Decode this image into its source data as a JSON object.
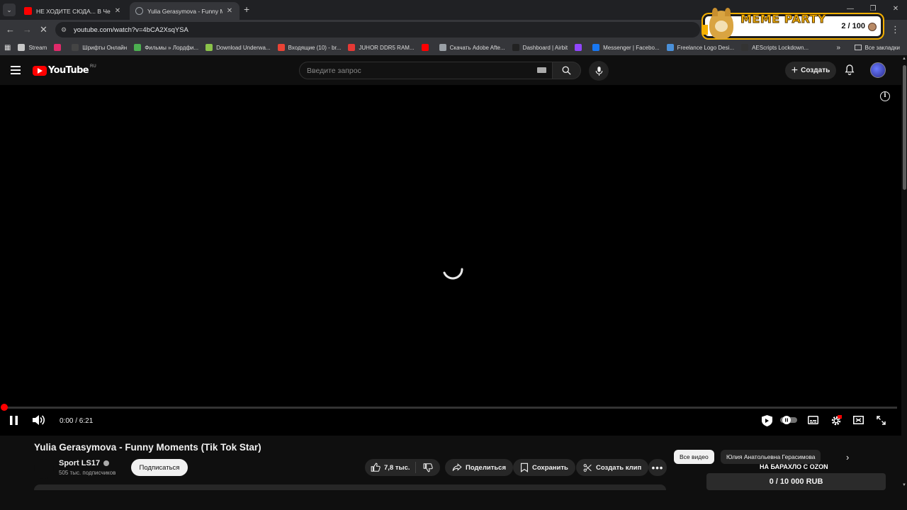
{
  "browser": {
    "tabs": [
      {
        "title": "НЕ ХОДИТЕ СЮДА... В Чернобыль",
        "favicon_color": "#ff0000",
        "active": false
      },
      {
        "title": "Yulia Gerasymova - Funny Moments",
        "favicon_color": "#9aa0a6",
        "active": true
      }
    ],
    "url": "youtube.com/watch?v=4bCA2XsqYSA",
    "bookmarks": [
      {
        "label": "Stream",
        "icon_color": "#c8c8c8"
      },
      {
        "label": "",
        "icon_color": "#e02a6a"
      },
      {
        "label": "Шрифты Онлайн",
        "icon_color": "#444444"
      },
      {
        "label": "Фильмы » Лордфи...",
        "icon_color": "#4caf50"
      },
      {
        "label": "Download Underwa...",
        "icon_color": "#8bc34a"
      },
      {
        "label": "Входящие (10) - br...",
        "icon_color": "#ea4335"
      },
      {
        "label": "JUHOR DDR5 RAM...",
        "icon_color": "#e53935"
      },
      {
        "label": "",
        "icon_color": "#ff0000"
      },
      {
        "label": "Скачать Adobe Afte...",
        "icon_color": "#9aa0a6"
      },
      {
        "label": "Dashboard | Airbit",
        "icon_color": "#222222"
      },
      {
        "label": "",
        "icon_color": "#9146ff"
      },
      {
        "label": "Messenger | Facebo...",
        "icon_color": "#1877f2"
      },
      {
        "label": "Freelance Logo Desi...",
        "icon_color": "#4a90d9"
      },
      {
        "label": "AEScripts Lockdown...",
        "icon_color": "#333333"
      }
    ],
    "all_bookmarks": "Все закладки"
  },
  "overlay": {
    "title": "MEME PARTY",
    "counter": "2 / 100"
  },
  "youtube": {
    "logo_text": "YouTube",
    "country_code": "RU",
    "search_placeholder": "Введите запрос",
    "create_label": "Создать"
  },
  "player": {
    "time": "0:00 / 6:21",
    "progress": 0.0,
    "state": "loading"
  },
  "video": {
    "title": "Yulia Gerasymova - Funny Moments (Tik Tok Star)",
    "channel": "Sport LS17",
    "subscribers": "505 тыс. подписчиков",
    "subscribe_label": "Подписаться",
    "likes": "7,8 тыс.",
    "share_label": "Поделиться",
    "save_label": "Сохранить",
    "clip_label": "Создать клип"
  },
  "sidebar": {
    "chips": [
      "Все видео",
      "Юлия Анатольевна Герасимова"
    ],
    "donation_label": "НА БАРАХЛО С OZON",
    "donation_progress": "0 / 10 000 RUB"
  },
  "colors": {
    "accent": "#ff0000",
    "background": "#0f0f0f",
    "overlay_gold": "#f5b000"
  }
}
